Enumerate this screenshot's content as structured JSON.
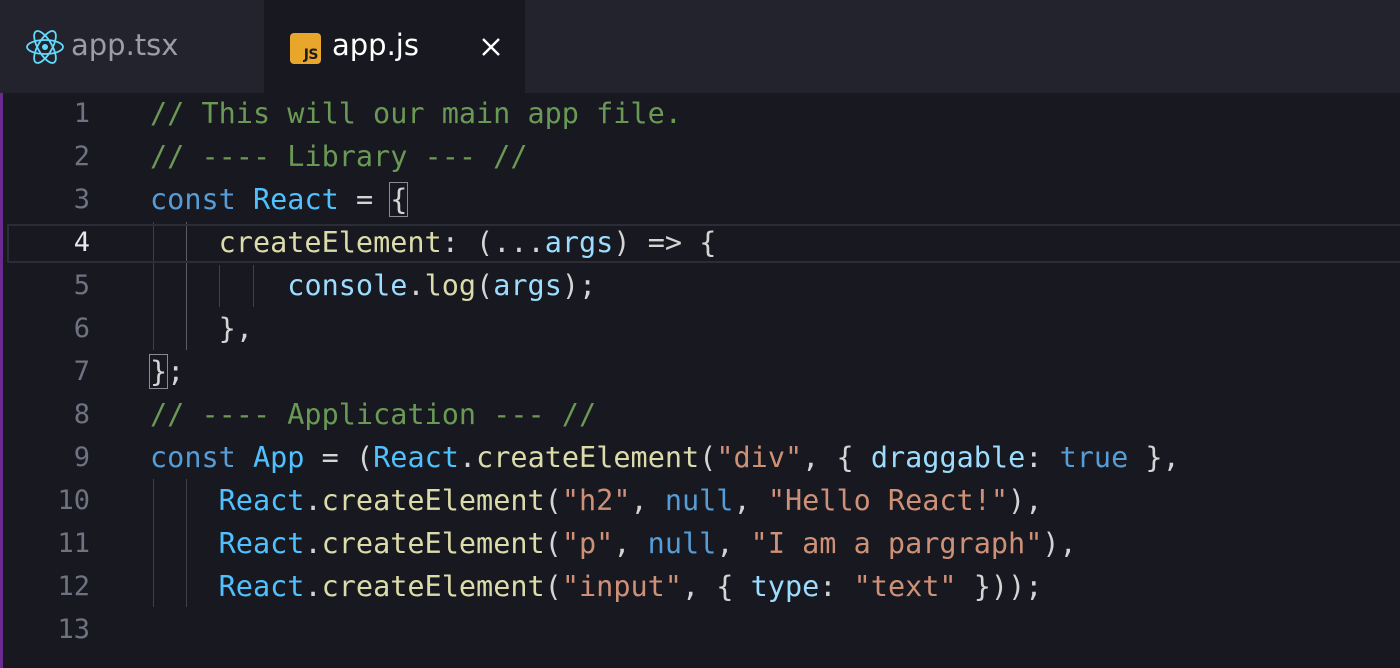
{
  "tabs": [
    {
      "label": "app.tsx",
      "icon": "react-icon",
      "active": false
    },
    {
      "label": "app.js",
      "icon": "js-icon",
      "icon_text": "JS",
      "active": true
    }
  ],
  "editor": {
    "current_line": 4,
    "lines": [
      {
        "num": "1",
        "text": "// This will our main app file."
      },
      {
        "num": "2",
        "text": "// ---- Library --- //"
      },
      {
        "num": "3",
        "text": "const React = {"
      },
      {
        "num": "4",
        "text": "    createElement: (...args) => {"
      },
      {
        "num": "5",
        "text": "        console.log(args);"
      },
      {
        "num": "6",
        "text": "    },"
      },
      {
        "num": "7",
        "text": "};"
      },
      {
        "num": "8",
        "text": "// ---- Application --- //"
      },
      {
        "num": "9",
        "text": "const App = (React.createElement(\"div\", { draggable: true },"
      },
      {
        "num": "10",
        "text": "    React.createElement(\"h2\", null, \"Hello React!\"),"
      },
      {
        "num": "11",
        "text": "    React.createElement(\"p\", null, \"I am a pargraph\"),"
      },
      {
        "num": "12",
        "text": "    React.createElement(\"input\", { type: \"text\" }));"
      },
      {
        "num": "13",
        "text": ""
      }
    ]
  },
  "colors": {
    "comment": "#6a9955",
    "keyword": "#569cd6",
    "variable": "#4fc1ff",
    "function": "#dcdcaa",
    "string": "#ce9178",
    "property": "#9cdcfe",
    "punctuation": "#d4d4d4",
    "js_badge": "#e8a72b",
    "background": "#181920"
  }
}
